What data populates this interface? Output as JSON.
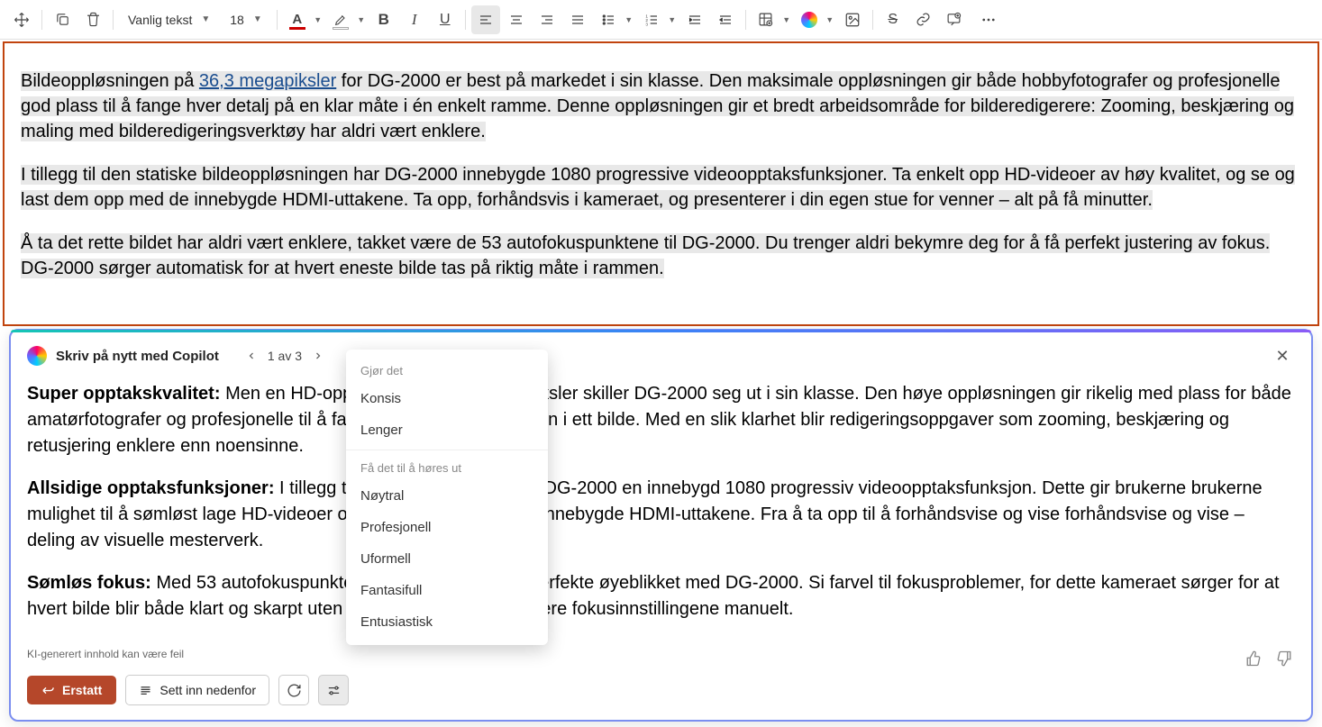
{
  "toolbar": {
    "style_select": "Vanlig tekst",
    "font_size": "18"
  },
  "document": {
    "link_text": "36,3 megapiksler",
    "p1_pre": "Bildeoppløsningen på ",
    "p1_post": " for DG-2000 er best på markedet i sin klasse. Den maksimale oppløsningen gir både hobbyfotografer og profesjonelle god plass til å fange hver detalj på en klar måte i én enkelt ramme. Denne oppløsningen gir et bredt arbeidsområde for bilderedigerere: Zooming, beskjæring og maling med bilderedigeringsverktøy har aldri vært enklere.",
    "p2": "I tillegg til den statiske bildeoppløsningen har DG-2000 innebygde 1080 progressive videoopptaksfunksjoner. Ta enkelt opp HD-videoer av høy kvalitet, og se og last dem opp med de innebygde HDMI-uttakene. Ta opp, forhåndsvis i kameraet, og presenterer i din egen stue for venner – alt på få minutter.",
    "p3": "Å ta det rette bildet har aldri vært enklere, takket være de 53 autofokuspunktene til DG-2000. Du trenger aldri bekymre deg for å få perfekt justering av fokus. DG-2000 sørger automatisk for at hvert eneste bilde tas på riktig måte i rammen."
  },
  "copilot": {
    "title": "Skriv på nytt med Copilot",
    "nav_text": "1 av 3",
    "p1_b": "Super opptakskvalitet:",
    "p1": " Men en HD-oppløsning på 36,3 megapiksler skiller DG-2000 seg ut i sin klasse. Den høye oppløsningen gir rikelig med plass for både amatørfotografer og profesjonelle til å fange detaljer med presisjon i ett bilde. Med en slik klarhet blir redigeringsoppgaver som zooming, beskjæring og retusjering enklere enn noensinne.",
    "p2_b": "Allsidige opptaksfunksjoner:",
    "p2": " I tillegg til statisk bildeopptak har DG-2000 en innebygd 1080 progressiv videoopptaksfunksjon. Dette gir brukerne brukerne mulighet til å sømløst lage HD-videoer og dele dem gjennom de innebygde HDMI-uttakene. Fra å ta opp til å forhåndsvise og vise forhåndsvise og vise – deling av visuelle mesterverk.",
    "p3_b": "Sømløs fokus:",
    "p3": " Med 53 autofokuspunkter fanger du enkelt det perfekte øyeblikket med DG-2000. Si farvel til fokusproblemer, for dette kameraet sørger for at hvert bilde blir både klart og skarpt uten å bekymre deg for å justere fokusinnstillingene manuelt.",
    "footer_note": "KI-generert innhold kan være feil",
    "replace_label": "Erstatt",
    "insert_label": "Sett inn nedenfor"
  },
  "dropdown": {
    "h1": "Gjør det",
    "i1": "Konsis",
    "i2": "Lenger",
    "h2": "Få det til å høres ut",
    "i3": "Nøytral",
    "i4": "Profesjonell",
    "i5": "Uformell",
    "i6": "Fantasifull",
    "i7": "Entusiastisk"
  }
}
